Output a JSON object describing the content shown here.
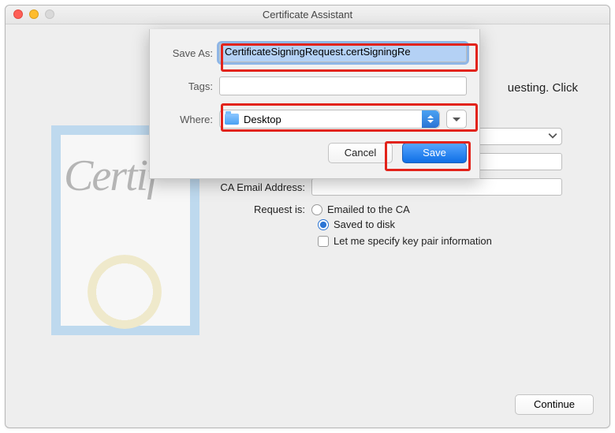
{
  "window": {
    "title": "Certificate Assistant"
  },
  "background": {
    "hint_line": "uesting. Click",
    "cert_script": "Certif"
  },
  "form": {
    "ca_label": "CA Email Address:",
    "ca_value": "",
    "request_label": "Request is:",
    "opt_email": "Emailed to the CA",
    "opt_disk": "Saved to disk",
    "opt_keypair": "Let me specify key pair information",
    "selected": "disk",
    "continue": "Continue"
  },
  "sheet": {
    "saveas_label": "Save As:",
    "saveas_value": "CertificateSigningRequest.certSigningRe",
    "tags_label": "Tags:",
    "tags_value": "",
    "where_label": "Where:",
    "where_value": "Desktop",
    "cancel": "Cancel",
    "save": "Save"
  }
}
